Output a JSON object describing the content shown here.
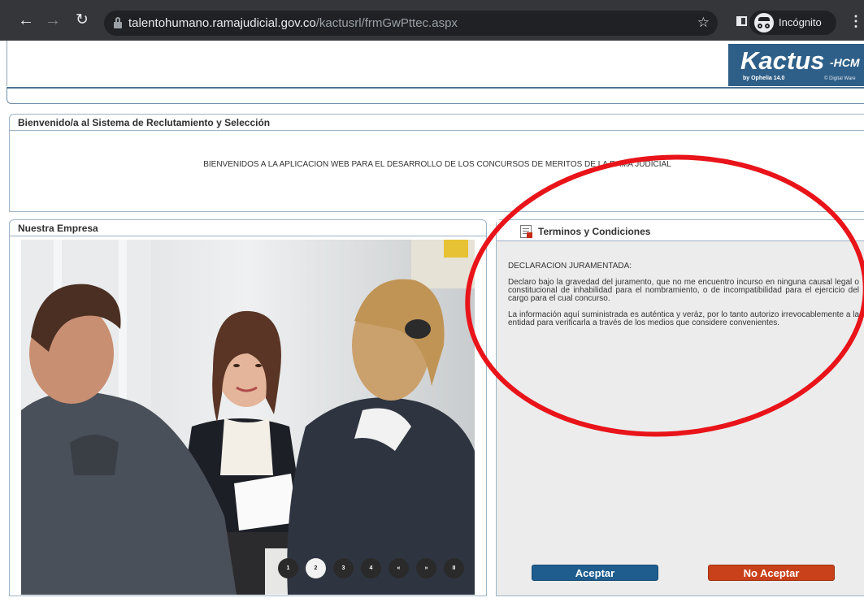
{
  "browser": {
    "url_host": "talentohumano.ramajudicial.gov.co",
    "url_path": "/kactusrl/frmGwPttec.aspx",
    "incognito_label": "Incógnito"
  },
  "logo": {
    "main": "Kactus",
    "suffix": "-HCM",
    "byline": "by Ophelia 14.0",
    "vendor": "© Digital Ware"
  },
  "welcome": {
    "title": "Bienvenido/a al Sistema de Reclutamiento y Selección",
    "message": "BIENVENIDOS A LA APLICACION WEB PARA EL DESARROLLO DE LOS CONCURSOS DE MERITOS DE LA RAMA JUDICIAL"
  },
  "empresa": {
    "title": "Nuestra Empresa",
    "pager": [
      "1",
      "2",
      "3",
      "4",
      "«",
      "»",
      "II"
    ],
    "active_page": "2"
  },
  "terms": {
    "title": "Terminos y Condiciones",
    "heading": "DECLARACION JURAMENTADA:",
    "paragraph1": "Declaro bajo la gravedad del juramento, que no me encuentro incurso en ninguna causal legal o constitucional de inhabilidad para el nombramiento, o de incompatibilidad para el ejercicio del cargo para el cual concurso.",
    "paragraph2": "La información aquí suministrada es auténtica y veráz, por lo tanto autorizo irrevocablemente a la entidad para verificarla a través de los medios que considere convenientes.",
    "accept_label": "Aceptar",
    "decline_label": "No Aceptar"
  },
  "colors": {
    "accent_blue": "#1f5d8f",
    "decline_red": "#c8411a",
    "annotation_red": "#e8141a"
  }
}
